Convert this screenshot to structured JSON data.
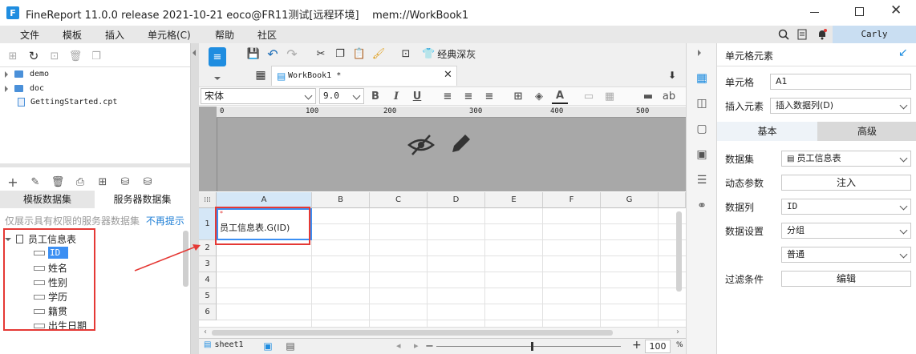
{
  "window": {
    "title": "FineReport 11.0.0 release 2021-10-21 eoco@FR11测试[远程环境]    mem://WorkBook1"
  },
  "menubar": {
    "items": [
      "文件",
      "模板",
      "插入",
      "单元格(C)",
      "帮助",
      "社区"
    ],
    "user": "Carly"
  },
  "left": {
    "tree": [
      {
        "label": "demo",
        "kind": "folder"
      },
      {
        "label": "doc",
        "kind": "folder"
      },
      {
        "label": "GettingStarted.cpt",
        "kind": "file"
      }
    ],
    "tabs": [
      "模板数据集",
      "服务器数据集"
    ],
    "notice": "仅展示具有权限的服务器数据集",
    "notice_link": "不再提示",
    "dataset": {
      "name": "员工信息表",
      "fields": [
        "ID",
        "姓名",
        "性别",
        "学历",
        "籍贯",
        "出生日期"
      ]
    }
  },
  "toolbar": {
    "theme_label": "经典深灰",
    "tab_label": "WorkBook1 *",
    "font": "宋体",
    "size": "9.0"
  },
  "ruler": [
    "0",
    "100",
    "200",
    "300",
    "400",
    "500"
  ],
  "grid": {
    "columns": [
      "A",
      "B",
      "C",
      "D",
      "E",
      "F",
      "G"
    ],
    "rows": [
      "1",
      "2",
      "3",
      "4",
      "5",
      "6"
    ],
    "cell_a1": "员工信息表.G(ID)"
  },
  "sheet": {
    "name": "sheet1",
    "zoom": "100",
    "zoom_unit": "%"
  },
  "props": {
    "title": "单元格元素",
    "cell_label": "单元格",
    "cell_value": "A1",
    "insert_label": "插入元素",
    "insert_value": "插入数据列(D)",
    "tabs": [
      "基本",
      "高级"
    ],
    "dataset_label": "数据集",
    "dataset_value": "员工信息表",
    "param_label": "动态参数",
    "param_btn": "注入",
    "column_label": "数据列",
    "column_value": "ID",
    "setting_label": "数据设置",
    "setting_value": "分组",
    "setting_value2": "普通",
    "filter_label": "过滤条件",
    "filter_btn": "编辑"
  },
  "colors": {
    "accent": "#1f8de0",
    "highlight": "#e53935",
    "selected": "#3b8ff3"
  }
}
